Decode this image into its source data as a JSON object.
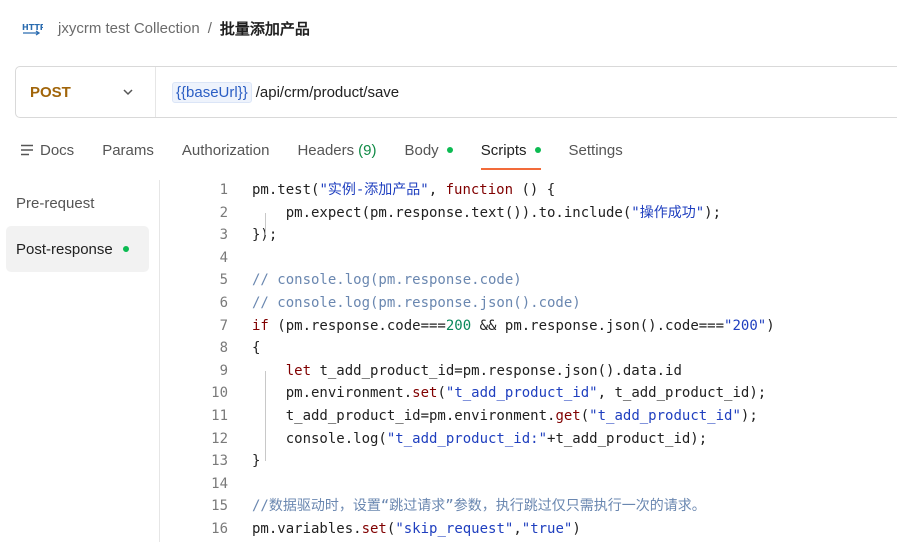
{
  "breadcrumb": {
    "icon": "http-icon",
    "collection": "jxycrm test Collection",
    "separator": "/",
    "request": "批量添加产品"
  },
  "request": {
    "method": "POST",
    "url_variable": "{{baseUrl}}",
    "url_path": "/api/crm/product/save"
  },
  "tabs": [
    {
      "label": "Docs",
      "icon": "docs-icon"
    },
    {
      "label": "Params"
    },
    {
      "label": "Authorization"
    },
    {
      "label": "Headers",
      "count": "(9)"
    },
    {
      "label": "Body",
      "dot": true
    },
    {
      "label": "Scripts",
      "dot": true,
      "active": true
    },
    {
      "label": "Settings"
    }
  ],
  "script_nav": [
    {
      "label": "Pre-request"
    },
    {
      "label": "Post-response",
      "dot": true,
      "active": true
    }
  ],
  "code_lines": [
    {
      "n": "1",
      "tokens": [
        [
          "t",
          "pm.test("
        ],
        [
          "s",
          "\"实例-添加产品\""
        ],
        [
          "t",
          ", "
        ],
        [
          "k",
          "function"
        ],
        [
          "t",
          " () {"
        ]
      ]
    },
    {
      "n": "2",
      "tokens": [
        [
          "t",
          "    pm.expect(pm.response.text()).to.include("
        ],
        [
          "s",
          "\"操作成功\""
        ],
        [
          "t",
          ");"
        ]
      ]
    },
    {
      "n": "3",
      "tokens": [
        [
          "t",
          "});"
        ]
      ]
    },
    {
      "n": "4",
      "tokens": [
        [
          "t",
          ""
        ]
      ]
    },
    {
      "n": "5",
      "tokens": [
        [
          "c",
          "// console.log(pm.response.code)"
        ]
      ]
    },
    {
      "n": "6",
      "tokens": [
        [
          "c",
          "// console.log(pm.response.json().code)"
        ]
      ]
    },
    {
      "n": "7",
      "tokens": [
        [
          "k",
          "if"
        ],
        [
          "t",
          " (pm.response.code==="
        ],
        [
          "n",
          "200"
        ],
        [
          "t",
          " && pm.response.json().code==="
        ],
        [
          "s",
          "\"200\""
        ],
        [
          "t",
          ")"
        ]
      ]
    },
    {
      "n": "8",
      "tokens": [
        [
          "t",
          "{"
        ]
      ]
    },
    {
      "n": "9",
      "tokens": [
        [
          "t",
          "    "
        ],
        [
          "k",
          "let"
        ],
        [
          "t",
          " t_add_product_id=pm.response.json().data.id"
        ]
      ]
    },
    {
      "n": "10",
      "tokens": [
        [
          "t",
          "    pm.environment."
        ],
        [
          "k",
          "set"
        ],
        [
          "t",
          "("
        ],
        [
          "s",
          "\"t_add_product_id\""
        ],
        [
          "t",
          ", t_add_product_id);"
        ]
      ]
    },
    {
      "n": "11",
      "tokens": [
        [
          "t",
          "    t_add_product_id=pm.environment."
        ],
        [
          "k",
          "get"
        ],
        [
          "t",
          "("
        ],
        [
          "s",
          "\"t_add_product_id\""
        ],
        [
          "t",
          ");"
        ]
      ]
    },
    {
      "n": "12",
      "tokens": [
        [
          "t",
          "    console.log("
        ],
        [
          "s",
          "\"t_add_product_id:\""
        ],
        [
          "t",
          "+t_add_product_id);"
        ]
      ]
    },
    {
      "n": "13",
      "tokens": [
        [
          "t",
          "}"
        ]
      ]
    },
    {
      "n": "14",
      "tokens": [
        [
          "t",
          ""
        ]
      ]
    },
    {
      "n": "15",
      "tokens": [
        [
          "c",
          "//数据驱动时，设置“跳过请求”参数，执行跳过仅只需执行一次的请求。"
        ]
      ]
    },
    {
      "n": "16",
      "tokens": [
        [
          "t",
          "pm.variables."
        ],
        [
          "k",
          "set"
        ],
        [
          "t",
          "("
        ],
        [
          "s",
          "\"skip_request\""
        ],
        [
          "t",
          ","
        ],
        [
          "s",
          "\"true\""
        ],
        [
          "t",
          ")"
        ]
      ]
    }
  ],
  "colors": {
    "method": "#a1650a",
    "accent": "#f26b3a",
    "dot": "#0cbb52",
    "keyword": "#800000",
    "string": "#1f3fbf",
    "number": "#09885a",
    "comment": "#6a87b0"
  }
}
